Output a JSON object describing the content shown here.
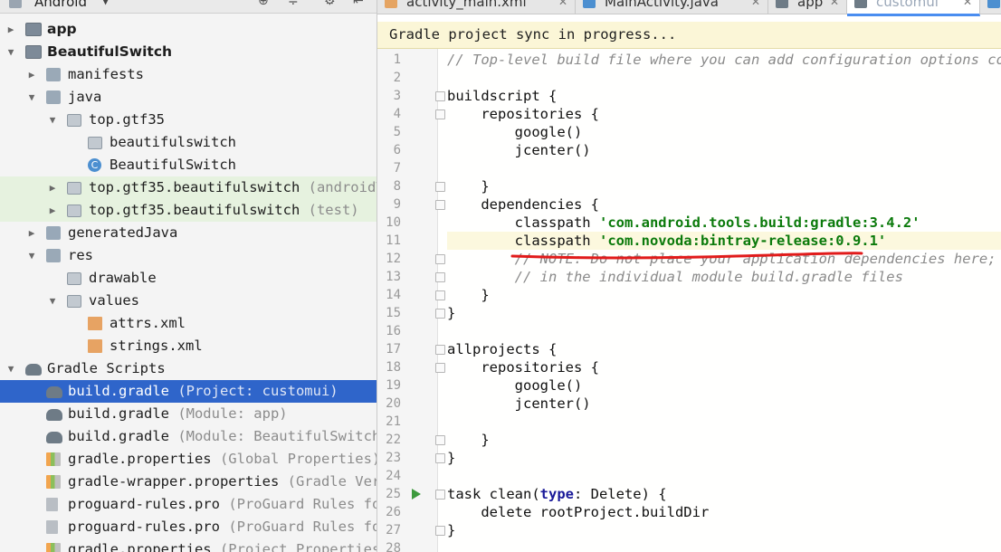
{
  "project_panel": {
    "view_title": "Android",
    "rows": [
      {
        "label": "app",
        "suffix": "",
        "icon": "module-folder-icon"
      },
      {
        "label": "BeautifulSwitch",
        "suffix": "",
        "icon": "module-folder-icon"
      },
      {
        "label": "manifests",
        "suffix": "",
        "icon": "folder-icon"
      },
      {
        "label": "java",
        "suffix": "",
        "icon": "folder-icon"
      },
      {
        "label": "top.gtf35",
        "suffix": "",
        "icon": "package-icon"
      },
      {
        "label": "beautifulswitch",
        "suffix": "",
        "icon": "package-icon"
      },
      {
        "label": "BeautifulSwitch",
        "suffix": "",
        "icon": "class-icon"
      },
      {
        "label": "top.gtf35.beautifulswitch",
        "suffix": " (androidTe",
        "icon": "package-icon"
      },
      {
        "label": "top.gtf35.beautifulswitch",
        "suffix": " (test)",
        "icon": "package-icon"
      },
      {
        "label": "generatedJava",
        "suffix": "",
        "icon": "generated-folder-icon"
      },
      {
        "label": "res",
        "suffix": "",
        "icon": "res-folder-icon"
      },
      {
        "label": "drawable",
        "suffix": "",
        "icon": "folder-icon"
      },
      {
        "label": "values",
        "suffix": "",
        "icon": "folder-icon"
      },
      {
        "label": "attrs.xml",
        "suffix": "",
        "icon": "xml-file-icon"
      },
      {
        "label": "strings.xml",
        "suffix": "",
        "icon": "xml-file-icon"
      },
      {
        "label": "Gradle Scripts",
        "suffix": "",
        "icon": "gradle-elephant-icon"
      },
      {
        "label": "build.gradle",
        "suffix": " (Project: customui)",
        "icon": "gradle-elephant-icon"
      },
      {
        "label": "build.gradle",
        "suffix": " (Module: app)",
        "icon": "gradle-elephant-icon"
      },
      {
        "label": "build.gradle",
        "suffix": " (Module: BeautifulSwitch)",
        "icon": "gradle-elephant-icon"
      },
      {
        "label": "gradle.properties",
        "suffix": " (Global Properties)",
        "icon": "properties-file-icon"
      },
      {
        "label": "gradle-wrapper.properties",
        "suffix": " (Gradle Vers",
        "icon": "properties-file-icon"
      },
      {
        "label": "proguard-rules.pro",
        "suffix": " (ProGuard Rules for",
        "icon": "text-file-icon"
      },
      {
        "label": "proguard-rules.pro",
        "suffix": " (ProGuard Rules for",
        "icon": "text-file-icon"
      },
      {
        "label": "gradle.properties",
        "suffix": " (Project Properties)",
        "icon": "properties-file-icon"
      }
    ]
  },
  "editor_tabs": [
    {
      "label": "activity_main.xml",
      "icon": "xml-file-icon",
      "active": false
    },
    {
      "label": "MainActivity.java",
      "icon": "class-icon",
      "active": false
    },
    {
      "label": "app",
      "icon": "gradle-elephant-icon",
      "active": false
    },
    {
      "label": "customui",
      "icon": "gradle-elephant-icon",
      "active": true
    },
    {
      "label": "",
      "icon": "class-icon",
      "active": false
    }
  ],
  "sync_banner": "Gradle project sync in progress...",
  "code": {
    "line_numbers": [
      "1",
      "2",
      "3",
      "4",
      "5",
      "6",
      "7",
      "8",
      "9",
      "10",
      "11",
      "12",
      "13",
      "14",
      "15",
      "16",
      "17",
      "18",
      "19",
      "20",
      "21",
      "22",
      "23",
      "24",
      "25",
      "26",
      "27",
      "28"
    ],
    "lines": [
      "// Top-level build file where you can add configuration options comm",
      "",
      "buildscript {",
      "    repositories {",
      "        google()",
      "        jcenter()",
      "",
      "    }",
      "    dependencies {",
      "        classpath 'com.android.tools.build:gradle:3.4.2'",
      "        classpath 'com.novoda:bintray-release:0.9.1'",
      "        // NOTE: Do not place your application dependencies here; th",
      "        // in the individual module build.gradle files",
      "    }",
      "}",
      "",
      "allprojects {",
      "    repositories {",
      "        google()",
      "        jcenter()",
      "",
      "    }",
      "}",
      "",
      "task clean(type: Delete) {",
      "    delete rootProject.buildDir",
      "}",
      ""
    ],
    "highlighted_line": "11"
  }
}
